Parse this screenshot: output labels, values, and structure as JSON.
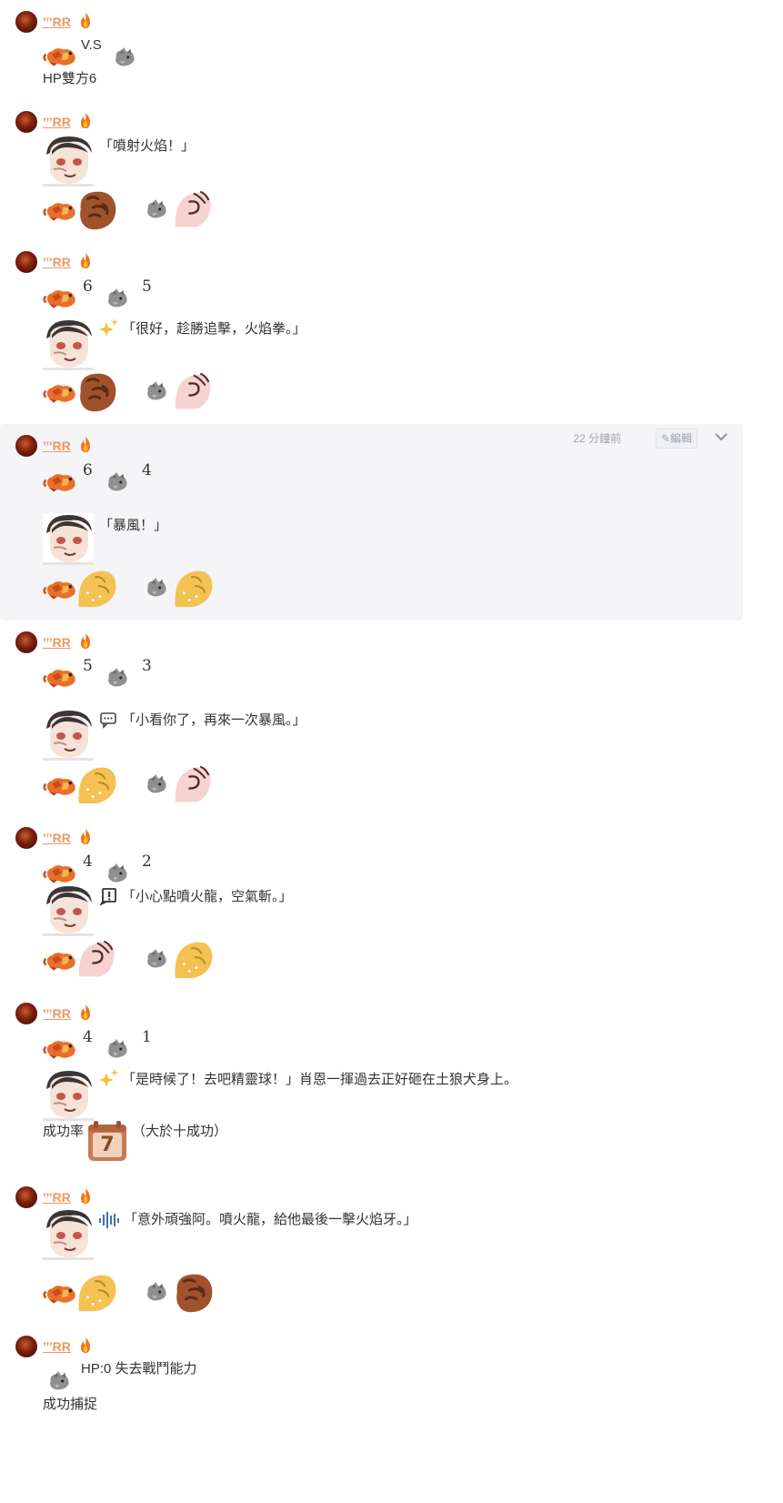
{
  "user": {
    "name": "’’’RR"
  },
  "posts": [
    {
      "lines": [
        "V.S",
        "HP雙方6"
      ]
    },
    {
      "quote": "「噴射火焰！」"
    },
    {
      "hp_left": "6",
      "hp_right": "5",
      "quote": "「很好，趁勝追擊，火焰拳。」"
    },
    {
      "hp_left": "6",
      "hp_right": "4",
      "quote": "「暴風！」",
      "time": "22 分鐘前",
      "edit": "編輯"
    },
    {
      "hp_left": "5",
      "hp_right": "3",
      "quote": "「小看你了，再來一次暴風。」"
    },
    {
      "hp_left": "4",
      "hp_right": "2",
      "quote": "「小心點噴火龍，空氣斬。」"
    },
    {
      "hp_left": "4",
      "hp_right": "1",
      "quote": "「是時候了！去吧精靈球！」肖恩一揮過去正好砸在土狼犬身上。",
      "rate_label": "成功率",
      "dice": "7",
      "rate_note": "（大於十成功）"
    },
    {
      "quote": "「意外頑強阿。噴火龍，給他最後一擊火焰牙。」"
    },
    {
      "lines": [
        "HP:0 失去戰鬥能力",
        "成功捕捉"
      ]
    }
  ],
  "colors": {
    "username": "#f0975f",
    "highlight_bg": "#f5f5f8",
    "rock": "#a0522d",
    "paper": "#f5c9c9",
    "scissors": "#f3c252"
  }
}
